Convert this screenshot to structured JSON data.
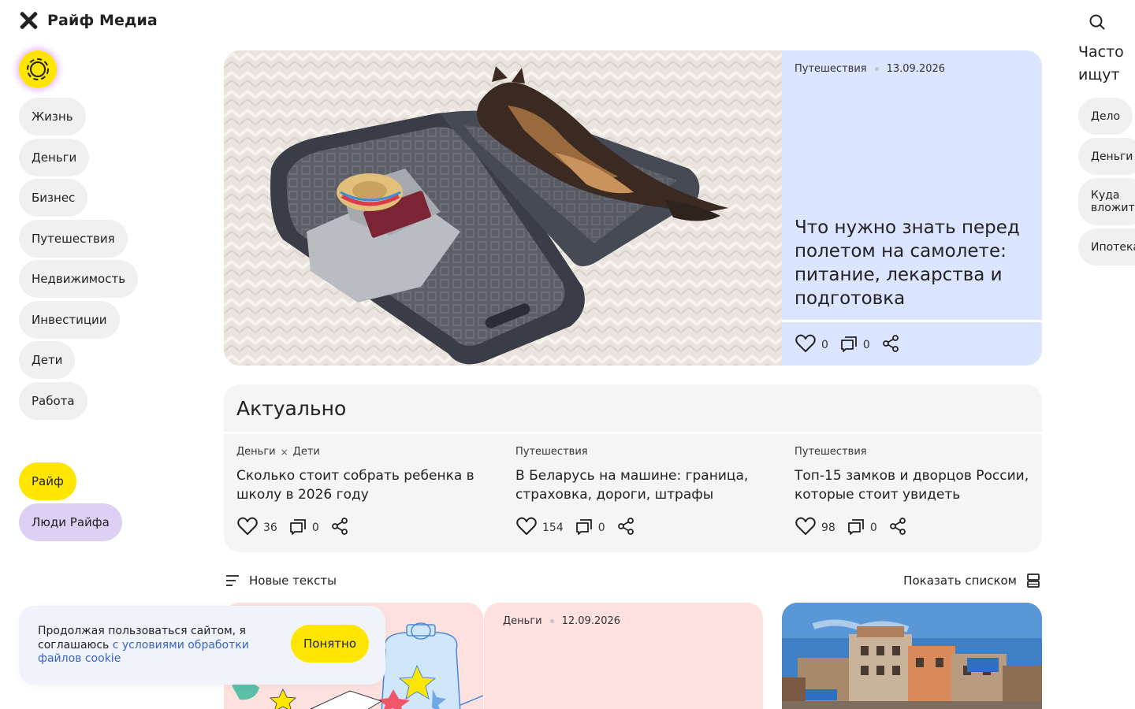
{
  "header": {
    "logo_text": "Райф Медиа"
  },
  "sidebar": {
    "items": [
      {
        "label": "Жизнь"
      },
      {
        "label": "Деньги"
      },
      {
        "label": "Бизнес"
      },
      {
        "label": "Путешествия"
      },
      {
        "label": "Недвижимость"
      },
      {
        "label": "Инвестиции"
      },
      {
        "label": "Дети"
      },
      {
        "label": "Работа"
      }
    ],
    "brand_links": [
      {
        "label": "Райф"
      },
      {
        "label": "Люди Райфа"
      }
    ]
  },
  "often_searched": {
    "title_line1": "Часто",
    "title_line2": "ищут",
    "items": [
      {
        "label": "Дело"
      },
      {
        "label": "Деньги"
      },
      {
        "label_line1": "Куда",
        "label_line2": "вложит"
      },
      {
        "label": "Ипотека"
      }
    ]
  },
  "hero": {
    "category": "Путешествия",
    "date": "13.09.2026",
    "title": "Что нужно знать перед полетом на самолете: питание, лекарства и подготовка",
    "likes": "0",
    "comments": "0"
  },
  "actual": {
    "title": "Актуально",
    "items": [
      {
        "tag1": "Деньги",
        "tag_sep": "×",
        "tag2": "Дети",
        "title": "Сколько стоит собрать ребенка в школу в 2026 году",
        "likes": "36",
        "comments": "0"
      },
      {
        "tag1": "Путешествия",
        "title": "В Беларусь на машине: граница, страховка, дороги, штрафы",
        "likes": "154",
        "comments": "0"
      },
      {
        "tag1": "Путешествия",
        "title": "Топ-15 замков и дворцов России, которые стоит увидеть",
        "likes": "98",
        "comments": "0"
      }
    ]
  },
  "toolbar": {
    "new_texts": "Новые тексты",
    "show_list": "Показать списком"
  },
  "cards": {
    "b": {
      "category": "Деньги",
      "date": "12.09.2026"
    }
  },
  "cookie": {
    "text": "Продолжая пользоваться сайтом, я соглашаюсь ",
    "link": "с условиями обработки файлов cookie",
    "button": "Понятно"
  },
  "colors": {
    "brand_yellow": "#fee600",
    "hero_card": "#dbe5ff",
    "pink_card": "#fde1df",
    "purple_pill": "#ddd0f5",
    "link": "#3a63c9"
  }
}
